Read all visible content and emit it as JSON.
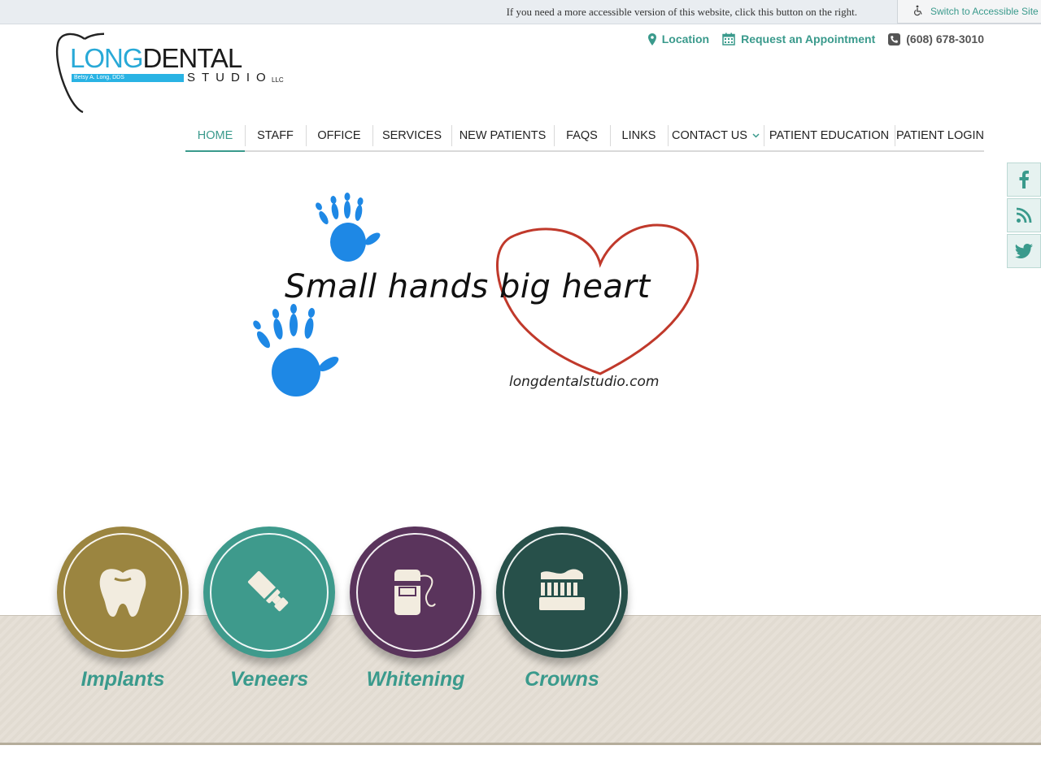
{
  "accessibility": {
    "message": "If you need a more accessible version of this website, click this button on the right.",
    "button_label": "Switch to Accessible Site"
  },
  "logo": {
    "long": "LONG",
    "dental": "DENTAL",
    "doctor": "Betsy A. Long, DDS",
    "studio": "STUDIO",
    "llc": "LLC"
  },
  "contacts": {
    "location": "Location",
    "appointment": "Request an Appointment",
    "phone": "(608) 678-3010"
  },
  "nav": {
    "items": [
      "HOME",
      "STAFF",
      "OFFICE",
      "SERVICES",
      "NEW PATIENTS",
      "FAQS",
      "LINKS",
      "CONTACT US",
      "PATIENT EDUCATION",
      "PATIENT LOGIN"
    ]
  },
  "hero": {
    "tagline": "Small hands big heart",
    "url": "longdentalstudio.com"
  },
  "services": [
    {
      "label": "Implants",
      "color": "#9b8540",
      "icon": "tooth-icon"
    },
    {
      "label": "Veneers",
      "color": "#3e9a8c",
      "icon": "toothpaste-icon"
    },
    {
      "label": "Whitening",
      "color": "#5a345c",
      "icon": "floss-icon"
    },
    {
      "label": "Crowns",
      "color": "#27504a",
      "icon": "toothbrush-icon"
    }
  ],
  "colors": {
    "accent": "#3a9a8c",
    "logo_blue": "#28a9d7",
    "heart_red": "#c0392b",
    "hand_blue": "#1e88e5"
  },
  "social": [
    "facebook-icon",
    "rss-icon",
    "twitter-icon"
  ]
}
